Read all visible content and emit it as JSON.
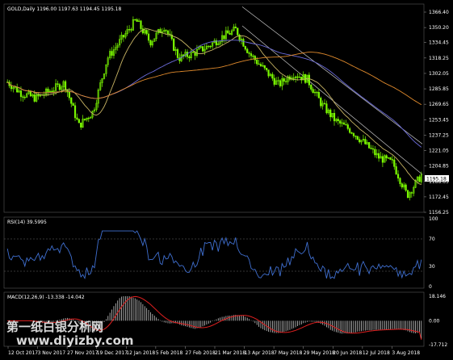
{
  "window": {
    "main_title": "GOLD,Daily  1196.00 1197.63 1194.45 1195.18",
    "rsi_title": "RSI(14) 39.5995",
    "macd_title": "MACD(12,26,9) -13.338 -14.042",
    "current_price": "1195.18"
  },
  "watermark": "第一纸白银分析网\nwww.diyizby.com",
  "price_axis": [
    "1366.40",
    "1350.20",
    "1334.45",
    "1318.25",
    "1302.05",
    "1285.85",
    "1269.65",
    "1253.45",
    "1237.25",
    "1221.05",
    "1204.85",
    "1188.65",
    "1172.45",
    "1156.25"
  ],
  "rsi_axis": [
    "100",
    "70",
    "30",
    "0"
  ],
  "macd_axis": [
    "18.146",
    "0.00",
    "-17.712"
  ],
  "time_axis": [
    "12 Oct 2017",
    "3 Nov 2017",
    "27 Nov 2017",
    "19 Dec 2017",
    "12 Jan 2018",
    "5 Feb 2018",
    "27 Feb 2018",
    "21 Mar 2018",
    "13 Apr 2018",
    "7 May 2018",
    "29 May 2018",
    "20 Jun 2018",
    "12 Jul 2018",
    "3 Aug 2018"
  ],
  "colors": {
    "bg": "#000000",
    "grid": "#3a3a3a",
    "candle": "#7cfc00",
    "ma_fast": "#c8b464",
    "ma_mid": "#6a6ad8",
    "ma_slow": "#e08a2c",
    "channel": "#c8c8c8",
    "rsi": "#3f6fd0",
    "macd_hist": "#c8c8c8",
    "macd_signal": "#e02020"
  },
  "chart_data": {
    "type": "candlestick",
    "symbol": "GOLD",
    "timeframe": "Daily",
    "ohlc_last": {
      "open": 1196.0,
      "high": 1197.63,
      "low": 1194.45,
      "close": 1195.18
    },
    "price_range": [
      1156.25,
      1366.4
    ],
    "close_path": [
      [
        "12 Oct 2017",
        1293
      ],
      [
        "20 Oct 2017",
        1281
      ],
      [
        "3 Nov 2017",
        1276
      ],
      [
        "15 Nov 2017",
        1284
      ],
      [
        "27 Nov 2017",
        1292
      ],
      [
        "7 Dec 2017",
        1247
      ],
      [
        "19 Dec 2017",
        1262
      ],
      [
        "3 Jan 2018",
        1318
      ],
      [
        "12 Jan 2018",
        1338
      ],
      [
        "25 Jan 2018",
        1358
      ],
      [
        "5 Feb 2018",
        1335
      ],
      [
        "15 Feb 2018",
        1352
      ],
      [
        "27 Feb 2018",
        1318
      ],
      [
        "10 Mar 2018",
        1323
      ],
      [
        "21 Mar 2018",
        1330
      ],
      [
        "1 Apr 2018",
        1340
      ],
      [
        "13 Apr 2018",
        1348
      ],
      [
        "25 Apr 2018",
        1322
      ],
      [
        "7 May 2018",
        1306
      ],
      [
        "18 May 2018",
        1290
      ],
      [
        "29 May 2018",
        1302
      ],
      [
        "8 Jun 2018",
        1296
      ],
      [
        "20 Jun 2018",
        1270
      ],
      [
        "1 Jul 2018",
        1252
      ],
      [
        "12 Jul 2018",
        1243
      ],
      [
        "23 Jul 2018",
        1229
      ],
      [
        "3 Aug 2018",
        1214
      ],
      [
        "10 Aug 2018",
        1208
      ],
      [
        "15 Aug 2018",
        1174
      ],
      [
        "20 Aug 2018",
        1195
      ]
    ],
    "rsi": {
      "period": 14,
      "last": 39.5995,
      "range": [
        0,
        100
      ],
      "levels": [
        30,
        70
      ]
    },
    "macd": {
      "params": [
        12,
        26,
        9
      ],
      "main": -13.338,
      "signal": -14.042,
      "range": [
        -17.712,
        18.146
      ]
    }
  }
}
